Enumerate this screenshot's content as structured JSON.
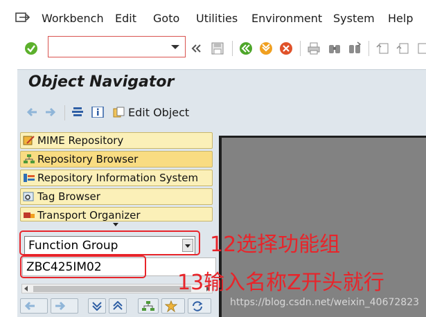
{
  "menubar": {
    "items": [
      "Workbench",
      "Edit",
      "Goto",
      "Utilities",
      "Environment",
      "System",
      "Help"
    ]
  },
  "toolbar": {
    "command_field_value": "",
    "icons": [
      "enter-check-icon",
      "back-icon",
      "exit-icon",
      "cancel-icon",
      "save-icon",
      "print-icon",
      "find-icon",
      "find-next-icon"
    ]
  },
  "title": "Object Navigator",
  "secondary_toolbar": {
    "edit_object_label": "Edit Object"
  },
  "navigator": {
    "buttons": [
      "MIME Repository",
      "Repository Browser",
      "Repository Information System",
      "Tag Browser",
      "Transport Organizer"
    ],
    "selected": "Repository Browser",
    "object_type_select": "Function Group",
    "object_name_input": "ZBC425IM02"
  },
  "annotations": {
    "step12": "12选择功能组",
    "step13": "13输入名称Z开头就行"
  },
  "watermark": "https://blog.csdn.net/weixin_40672823",
  "colors": {
    "annotation": "#e8242a",
    "nav_button": "#fbf0b8",
    "nav_button_selected": "#f9dc82",
    "panel": "#dfe6ec",
    "right_pane": "#828282"
  }
}
